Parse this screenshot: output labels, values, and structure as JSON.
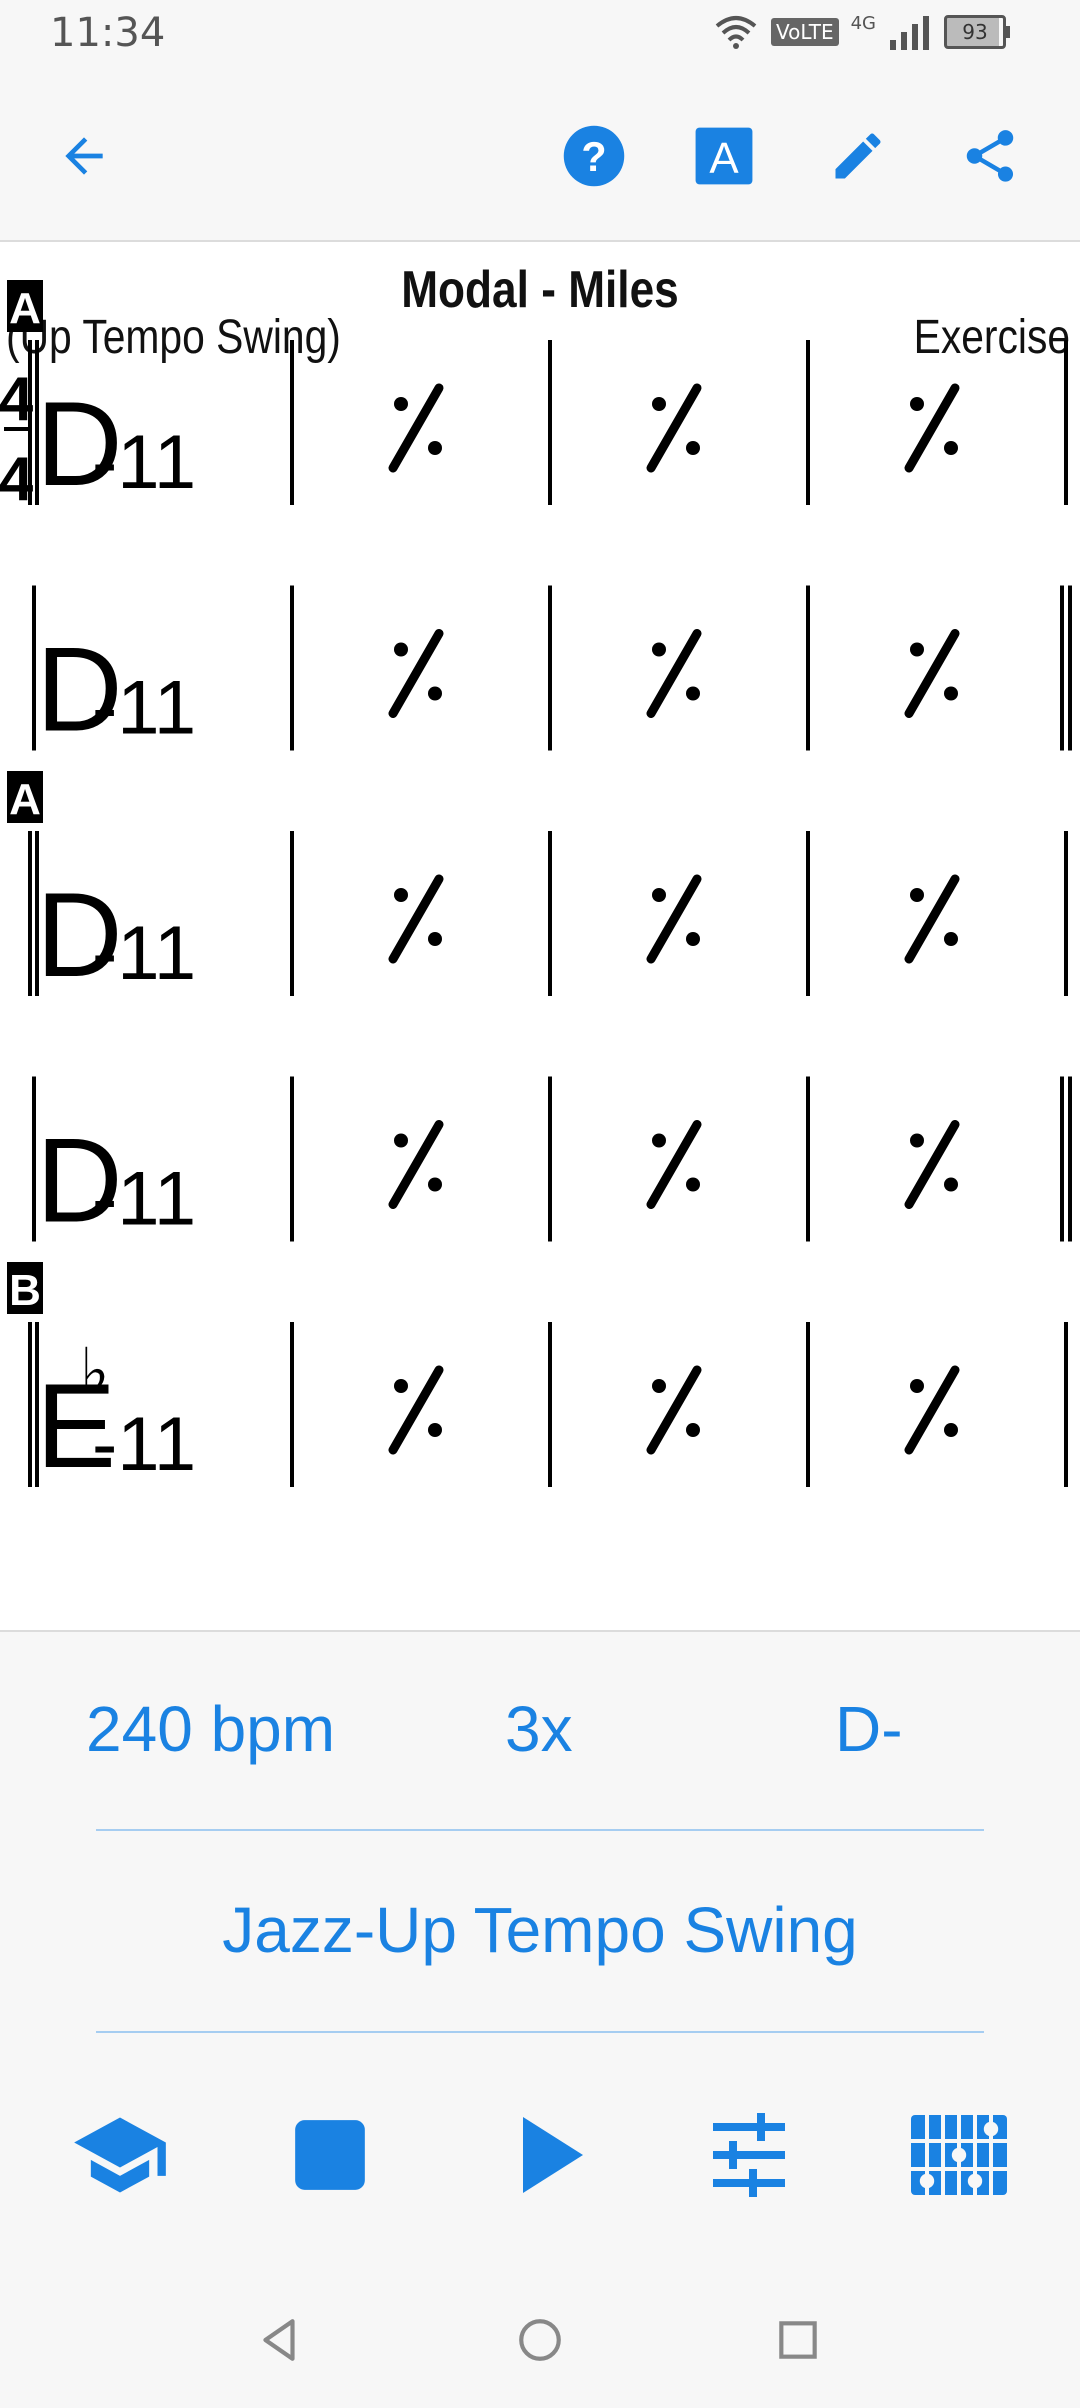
{
  "status_bar": {
    "time": "11:34",
    "volte": "VoLTE",
    "network": "4G",
    "battery": "93"
  },
  "toolbar": {
    "back_icon": "arrow-left-icon",
    "help_icon": "help-circle-icon",
    "font_icon": "font-a-icon",
    "edit_icon": "pencil-icon",
    "share_icon": "share-icon"
  },
  "song": {
    "title": "Modal - Miles",
    "style": "(Up Tempo Swing)",
    "composer": "Exercise",
    "time_signature_top": "4",
    "time_signature_bottom": "4",
    "rows": [
      {
        "section": "A",
        "chord_root": "D",
        "chord_accidental": "",
        "chord_quality": "-11",
        "repeat": "%",
        "end": "single"
      },
      {
        "section": "",
        "chord_root": "D",
        "chord_accidental": "",
        "chord_quality": "-11",
        "repeat": "%",
        "end": "double"
      },
      {
        "section": "A",
        "chord_root": "D",
        "chord_accidental": "",
        "chord_quality": "-11",
        "repeat": "%",
        "end": "single"
      },
      {
        "section": "",
        "chord_root": "D",
        "chord_accidental": "",
        "chord_quality": "-11",
        "repeat": "%",
        "end": "double"
      },
      {
        "section": "B",
        "chord_root": "E",
        "chord_accidental": "♭",
        "chord_quality": "-11",
        "repeat": "%",
        "end": "single"
      }
    ]
  },
  "controls": {
    "tempo": "240 bpm",
    "repeats": "3x",
    "key": "D-",
    "style": "Jazz-Up Tempo Swing"
  },
  "bottom_bar": {
    "practice_icon": "graduation-cap-icon",
    "stop_icon": "stop-icon",
    "play_icon": "play-icon",
    "mixer_icon": "sliders-icon",
    "chord_diagram_icon": "fretboard-icon"
  },
  "colors": {
    "accent": "#1a82e2",
    "separator": "#a6cdf1"
  }
}
